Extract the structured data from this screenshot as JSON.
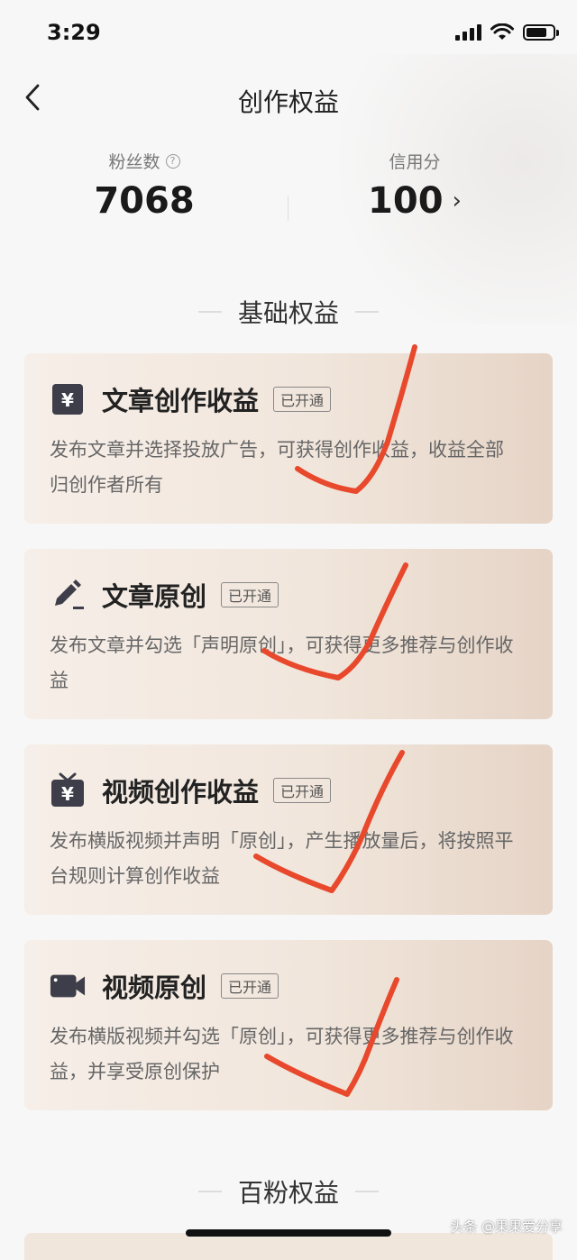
{
  "status_bar": {
    "time": "3:29"
  },
  "nav": {
    "title": "创作权益"
  },
  "stats": {
    "fans_label": "粉丝数",
    "fans_value": "7068",
    "credit_label": "信用分",
    "credit_value": "100"
  },
  "sections": {
    "basic": "基础权益",
    "hundred_fans": "百粉权益"
  },
  "cards": [
    {
      "title": "文章创作收益",
      "badge": "已开通",
      "desc": "发布文章并选择投放广告，可获得创作收益，收益全部归创作者所有",
      "icon": "yuan-card-icon"
    },
    {
      "title": "文章原创",
      "badge": "已开通",
      "desc": "发布文章并勾选「声明原创」，可获得更多推荐与创作收益",
      "icon": "pencil-icon"
    },
    {
      "title": "视频创作收益",
      "badge": "已开通",
      "desc": "发布横版视频并声明「原创」，产生播放量后，将按照平台规则计算创作收益",
      "icon": "tv-yuan-icon"
    },
    {
      "title": "视频原创",
      "badge": "已开通",
      "desc": "发布横版视频并勾选「原创」，可获得更多推荐与创作收益，并享受原创保护",
      "icon": "video-camera-icon"
    }
  ],
  "watermark": "头条 @果果爱分享",
  "colors": {
    "check_red": "#e8482c",
    "card_icon": "#3e3e4a"
  }
}
